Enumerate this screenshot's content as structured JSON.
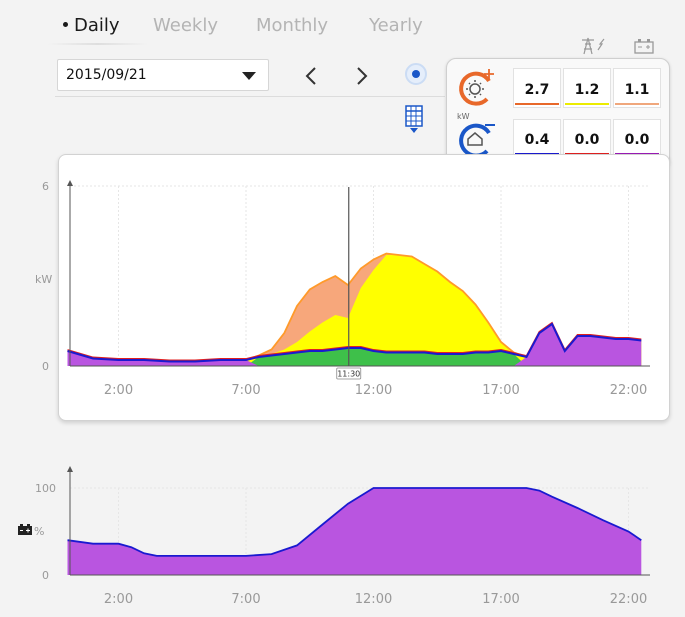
{
  "tabs": [
    {
      "label": "Daily",
      "active": true
    },
    {
      "label": "Weekly",
      "active": false
    },
    {
      "label": "Monthly",
      "active": false
    },
    {
      "label": "Yearly",
      "active": false
    }
  ],
  "date_select": {
    "value": "2015/09/21"
  },
  "summary": {
    "unit": "kW",
    "production": [
      "2.7",
      "1.2",
      "1.1"
    ],
    "consumption": [
      "0.4",
      "0.0",
      "0.0"
    ],
    "production_colors": [
      "#e8682a",
      "#ecec00",
      "#f0a77c"
    ],
    "consumption_colors": [
      "#1a1ad0",
      "#e02020",
      "#9a1ab6"
    ]
  },
  "colors": {
    "solar_direct": "#ffff00",
    "solar_outline": "#ff9a2a",
    "export_orange": "#f7a77b",
    "self_consumption": "#3ec04a",
    "battery_purple": "#b955e0",
    "load_line": "#1a1ad0",
    "grid_red": "#e02020"
  },
  "chart_data": [
    {
      "type": "area",
      "ylabel": "kW",
      "yticks": [
        "6",
        "0"
      ],
      "ylim": [
        0,
        6
      ],
      "xticks": [
        "2:00",
        "7:00",
        "12:00",
        "17:00",
        "22:00"
      ],
      "cursor_label": "11:30",
      "x": [
        0,
        1,
        2,
        3,
        4,
        5,
        6,
        7,
        7.5,
        8,
        8.5,
        9,
        9.5,
        10,
        10.5,
        11,
        11.5,
        12,
        12.5,
        13,
        13.5,
        14,
        14.5,
        15,
        15.5,
        16,
        16.5,
        17,
        17.5,
        18,
        18.5,
        19,
        19.5,
        20,
        20.5,
        21,
        21.5,
        22,
        22.5
      ],
      "series": [
        {
          "values": [
            0.5,
            0.25,
            0.2,
            0.2,
            0.15,
            0.15,
            0.2,
            0.2,
            0.3,
            0.35,
            0.4,
            0.45,
            0.5,
            0.5,
            0.55,
            0.6,
            0.6,
            0.5,
            0.45,
            0.45,
            0.45,
            0.45,
            0.4,
            0.4,
            0.4,
            0.45,
            0.45,
            0.5,
            0.4,
            0.3,
            1.1,
            1.4,
            0.5,
            1.0,
            1.0,
            0.95,
            0.9,
            0.9,
            0.85
          ]
        },
        {
          "values": [
            0.5,
            0.25,
            0.2,
            0.2,
            0.15,
            0.15,
            0.2,
            0.2,
            0.3,
            0.4,
            0.55,
            0.8,
            1.15,
            1.45,
            1.7,
            1.6,
            2.6,
            3.2,
            3.7,
            3.7,
            3.65,
            3.4,
            3.15,
            2.8,
            2.5,
            2.05,
            1.45,
            0.8,
            0.45,
            0.3,
            1.1,
            1.4,
            0.5,
            1.0,
            1.0,
            0.95,
            0.9,
            0.9,
            0.85
          ]
        },
        {
          "values": [
            0.5,
            0.25,
            0.2,
            0.2,
            0.15,
            0.15,
            0.2,
            0.2,
            0.35,
            0.55,
            1.1,
            2.0,
            2.55,
            2.8,
            3.0,
            2.7,
            3.25,
            3.55,
            3.75,
            3.7,
            3.65,
            3.4,
            3.15,
            2.8,
            2.5,
            2.05,
            1.45,
            0.8,
            0.45,
            0.3,
            1.1,
            1.4,
            0.5,
            1.0,
            1.0,
            0.95,
            0.9,
            0.9,
            0.85
          ]
        }
      ]
    },
    {
      "type": "area",
      "ylabel": "%",
      "yticks": [
        "100",
        "0"
      ],
      "ylim": [
        0,
        100
      ],
      "xticks": [
        "2:00",
        "7:00",
        "12:00",
        "17:00",
        "22:00"
      ],
      "x": [
        0,
        1,
        2,
        2.5,
        3,
        3.5,
        4,
        5,
        6,
        7,
        8,
        9,
        10,
        11,
        12,
        13,
        14,
        15,
        16,
        17,
        18,
        18.5,
        19,
        20,
        21,
        22,
        22.5
      ],
      "series": [
        {
          "values": [
            40,
            36,
            36,
            32,
            25,
            22,
            22,
            22,
            22,
            22,
            24,
            34,
            58,
            82,
            100,
            100,
            100,
            100,
            100,
            100,
            100,
            97,
            90,
            77,
            63,
            50,
            40
          ]
        }
      ]
    }
  ]
}
